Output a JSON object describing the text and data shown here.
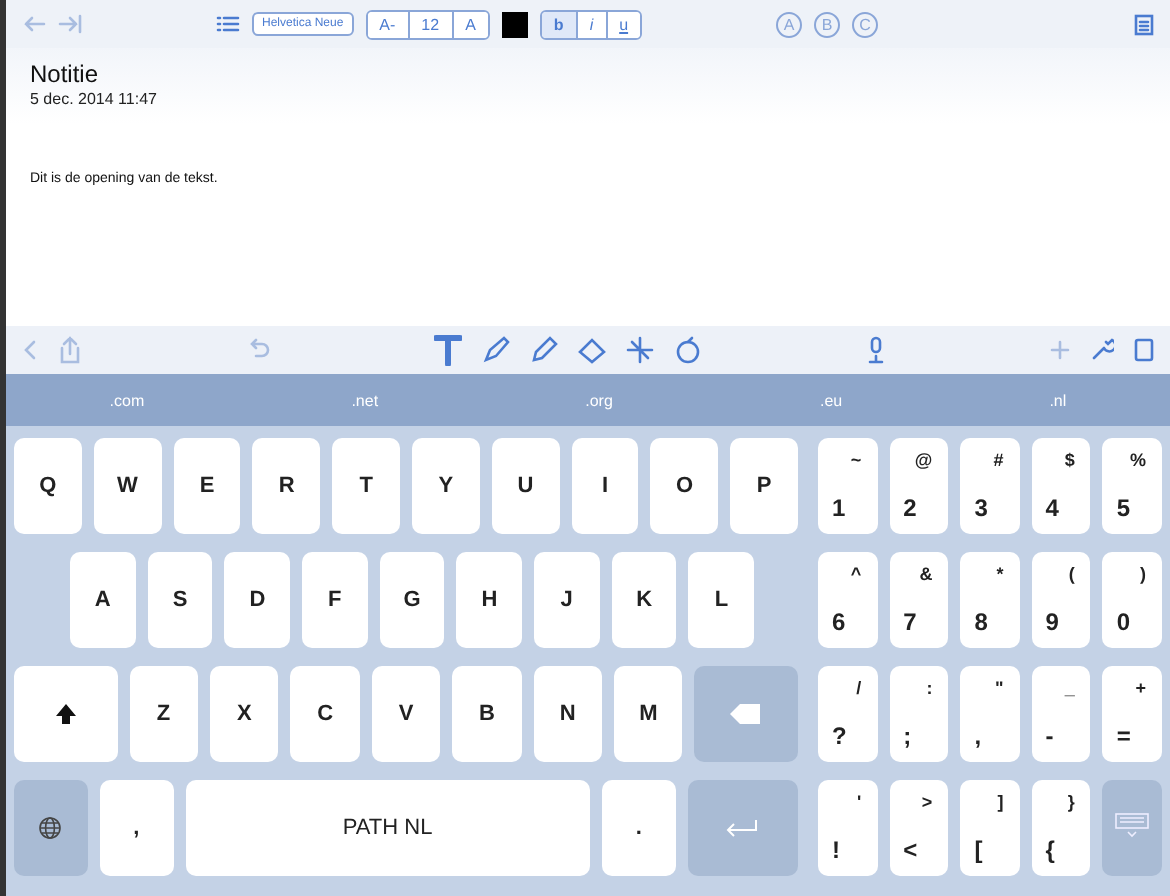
{
  "toolbar": {
    "font_button": "Helvetica Neue",
    "size_buttons": [
      "A-",
      "12",
      "A"
    ],
    "style_buttons": [
      {
        "label": "b",
        "selected": true
      },
      {
        "label": "i",
        "selected": false
      },
      {
        "label": "u",
        "selected": false
      }
    ],
    "preset_buttons": [
      "A",
      "B",
      "C"
    ]
  },
  "note": {
    "title": "Notitie",
    "date": "5 dec. 2014 11:47",
    "body": "Dit is de opening van de tekst."
  },
  "suggestions": [
    ".com",
    ".net",
    ".org",
    ".eu",
    ".nl"
  ],
  "keyboard": {
    "rows": [
      {
        "keys": [
          {
            "kind": "letter",
            "label": "Q"
          },
          {
            "kind": "letter",
            "label": "W"
          },
          {
            "kind": "letter",
            "label": "E"
          },
          {
            "kind": "letter",
            "label": "R"
          },
          {
            "kind": "letter",
            "label": "T"
          },
          {
            "kind": "letter",
            "label": "Y"
          },
          {
            "kind": "letter",
            "label": "U"
          },
          {
            "kind": "letter",
            "label": "I"
          },
          {
            "kind": "letter",
            "label": "O"
          },
          {
            "kind": "letter",
            "label": "P"
          }
        ]
      },
      {
        "keys": [
          {
            "kind": "letter",
            "label": "A"
          },
          {
            "kind": "letter",
            "label": "S"
          },
          {
            "kind": "letter",
            "label": "D"
          },
          {
            "kind": "letter",
            "label": "F"
          },
          {
            "kind": "letter",
            "label": "G"
          },
          {
            "kind": "letter",
            "label": "H"
          },
          {
            "kind": "letter",
            "label": "J"
          },
          {
            "kind": "letter",
            "label": "K"
          },
          {
            "kind": "letter",
            "label": "L"
          }
        ]
      },
      {
        "keys": [
          {
            "kind": "shift"
          },
          {
            "kind": "letter",
            "label": "Z"
          },
          {
            "kind": "letter",
            "label": "X"
          },
          {
            "kind": "letter",
            "label": "C"
          },
          {
            "kind": "letter",
            "label": "V"
          },
          {
            "kind": "letter",
            "label": "B"
          },
          {
            "kind": "letter",
            "label": "N"
          },
          {
            "kind": "letter",
            "label": "M"
          },
          {
            "kind": "backspace"
          }
        ]
      },
      {
        "keys": [
          {
            "kind": "globe"
          },
          {
            "kind": "letter",
            "label": ","
          },
          {
            "kind": "space",
            "label": "PATH NL"
          },
          {
            "kind": "letter",
            "label": "."
          },
          {
            "kind": "return"
          }
        ]
      }
    ],
    "numpad": [
      {
        "keys": [
          {
            "kind": "symbol",
            "main": "1",
            "alt": "~"
          },
          {
            "kind": "symbol",
            "main": "2",
            "alt": "@"
          },
          {
            "kind": "symbol",
            "main": "3",
            "alt": "#"
          },
          {
            "kind": "symbol",
            "main": "4",
            "alt": "$"
          },
          {
            "kind": "symbol",
            "main": "5",
            "alt": "%"
          }
        ]
      },
      {
        "keys": [
          {
            "kind": "symbol",
            "main": "6",
            "alt": "^"
          },
          {
            "kind": "symbol",
            "main": "7",
            "alt": "&"
          },
          {
            "kind": "symbol",
            "main": "8",
            "alt": "*"
          },
          {
            "kind": "symbol",
            "main": "9",
            "alt": "("
          },
          {
            "kind": "symbol",
            "main": "0",
            "alt": ")"
          }
        ]
      },
      {
        "keys": [
          {
            "kind": "symbol",
            "main": "?",
            "alt": "/"
          },
          {
            "kind": "symbol",
            "main": ";",
            "alt": ":"
          },
          {
            "kind": "symbol",
            "main": ",",
            "alt": "\""
          },
          {
            "kind": "symbol",
            "main": "-",
            "alt": "_"
          },
          {
            "kind": "symbol",
            "main": "=",
            "alt": "+"
          }
        ]
      },
      {
        "keys": [
          {
            "kind": "symbol",
            "main": "!",
            "alt": "'"
          },
          {
            "kind": "symbol",
            "main": "<",
            "alt": ">"
          },
          {
            "kind": "symbol",
            "main": "[",
            "alt": "]"
          },
          {
            "kind": "symbol",
            "main": "{",
            "alt": "}"
          },
          {
            "kind": "hide"
          }
        ]
      }
    ]
  }
}
